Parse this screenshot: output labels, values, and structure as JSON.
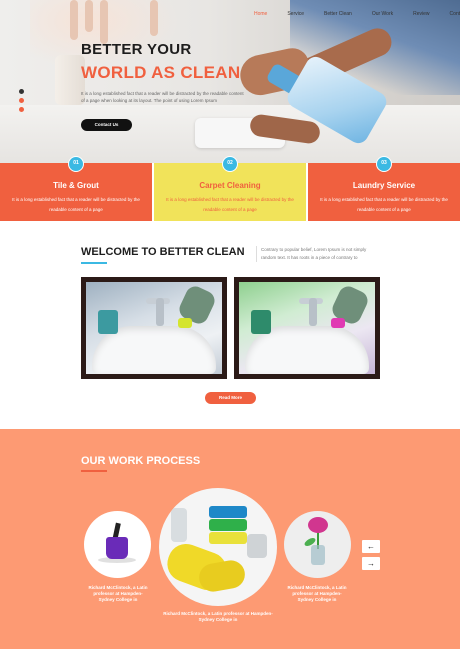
{
  "nav": {
    "items": [
      {
        "label": "Home",
        "active": true
      },
      {
        "label": "Service"
      },
      {
        "label": "Better Clean"
      },
      {
        "label": "Our Work"
      },
      {
        "label": "Review"
      },
      {
        "label": "Contact us"
      }
    ]
  },
  "hero": {
    "title_line1": "BETTER YOUR",
    "title_line2": "WORLD AS CLEAN",
    "description": "It is a long established fact that a reader will be distracted by the readable content of a page when looking at its layout. The point of using Lorem Ipsum",
    "button_label": "Contact Us"
  },
  "services": [
    {
      "number": "01",
      "title": "Tile & Grout",
      "description": "It is a long established fact that a reader will be distracted by the readable content of a page"
    },
    {
      "number": "02",
      "title": "Carpet Cleaning",
      "description": "It is a long established fact that a reader will be distracted by the readable content of a page"
    },
    {
      "number": "03",
      "title": "Laundry Service",
      "description": "It is a long established fact that a reader will be distracted by the readable content of a page"
    }
  ],
  "welcome": {
    "title": "WELCOME TO BETTER CLEAN",
    "description": "Contrary to popular belief, Lorem Ipsum is not simply random text. It has roots in a piece of contrary to",
    "read_more_label": "Read More"
  },
  "process": {
    "title": "OUR WORK PROCESS",
    "captions": [
      "Richard McClintock, a Latin professor at Hampden-Sydney College in",
      "Richard McClintock, a Latin professor at Hampden-Sydney College in",
      "Richard McClintock, a Latin professor at Hampden-Sydney College in"
    ],
    "prev_symbol": "←",
    "next_symbol": "→"
  },
  "colors": {
    "accent": "#f0603f",
    "yellow": "#f1e35a",
    "blue": "#3bb9e3",
    "process_bg": "#fd9a73"
  }
}
